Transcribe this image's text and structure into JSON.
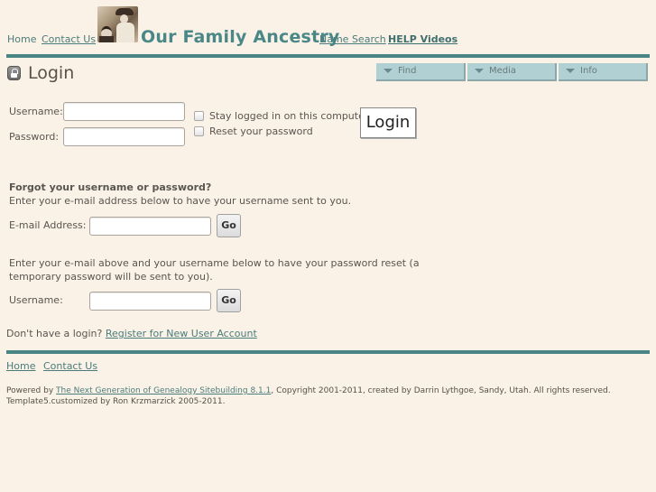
{
  "header": {
    "nav_home": "Home",
    "nav_contact": "Contact Us",
    "site_title": "Our Family Ancestry",
    "nav_name_search": "Name Search",
    "nav_help_videos": "HELP Videos",
    "photo_alt": "family-photo"
  },
  "menu": {
    "tabs": [
      {
        "label": "Find"
      },
      {
        "label": "Media"
      },
      {
        "label": "Info"
      }
    ]
  },
  "login": {
    "title": "Login",
    "username_label": "Username:",
    "username_value": "",
    "password_label": "Password:",
    "password_value": "",
    "stay_logged_in_label": "Stay logged in on this computer",
    "reset_password_label": "Reset your password",
    "login_button": "Login"
  },
  "forgot": {
    "heading": "Forgot your username or password?",
    "email_instructions": "Enter your e-mail address below to have your username sent to you.",
    "email_label": "E-mail Address:",
    "email_value": "",
    "go_button": "Go",
    "reset_instructions": "Enter your e-mail above and your username below to have your password reset (a temporary password will be sent to you).",
    "username_label": "Username:",
    "username_value": "",
    "go_button_2": "Go"
  },
  "register": {
    "prompt": "Don't have a login?",
    "link": "Register for New User Account"
  },
  "footer": {
    "nav_home": "Home",
    "nav_contact": "Contact Us",
    "powered_prefix": "Powered by",
    "powered_link": "The Next Generation of Genealogy Sitebuilding 8.1.1",
    "powered_suffix": ", Copyright 2001-2011, created by Darrin Lythgoe, Sandy, Utah. All rights reserved.",
    "template_credit": "Template5.customized by Ron Krzmarzick 2005-2011."
  },
  "colors": {
    "background": "#faf2e6",
    "accent": "#4a8585",
    "menu_tab": "#b0d0d4",
    "link": "#4a7c7c"
  }
}
